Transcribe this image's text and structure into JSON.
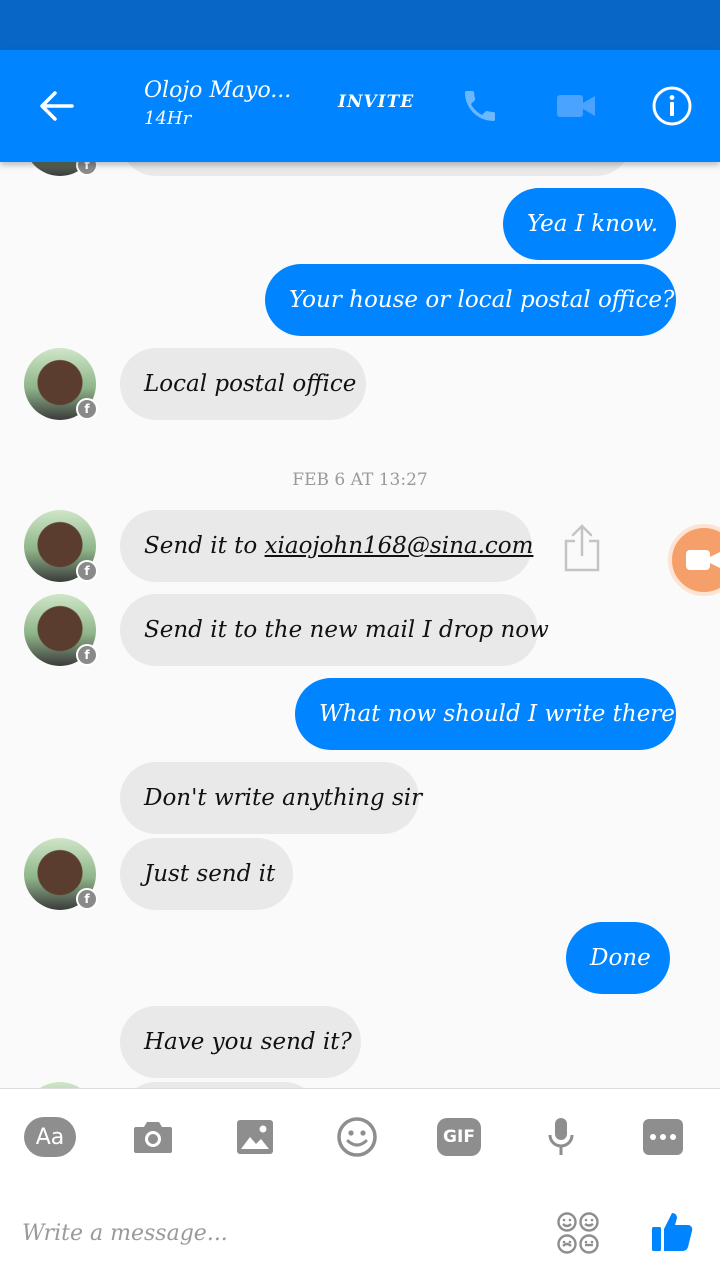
{
  "colors": {
    "brand_blue": "#0084ff",
    "status_bar": "#0866c6",
    "incoming_bubble": "#e9e9e9",
    "icon_gray": "#8e8e8e"
  },
  "header": {
    "contact_name": "Olojo Mayo...",
    "contact_status": "14Hr",
    "invite_label": "INVITE",
    "icons": [
      "back-arrow-icon",
      "phone-icon",
      "video-camera-icon",
      "info-icon"
    ]
  },
  "messages": {
    "m1": "Yea I know.",
    "m2": "Your house or local postal office?",
    "m3": "Local postal office",
    "date_separator": "FEB 6 AT 13:27",
    "m4_prefix": "Send it to ",
    "m4_link": "xiaojohn168@sina.com",
    "m5": "Send it to the new mail I drop now",
    "m6": "What now should I write there.",
    "m7": "Don't write anything sir",
    "m8": "Just send it",
    "m9": "Done",
    "m10": "Have you send it?"
  },
  "composer": {
    "aa_label": "Aa",
    "gif_label": "GIF",
    "placeholder": "Write a message...",
    "icons": [
      "camera-icon",
      "image-icon",
      "emoji-icon",
      "microphone-icon",
      "more-icon",
      "stickers-icon",
      "thumbs-up-icon"
    ]
  }
}
